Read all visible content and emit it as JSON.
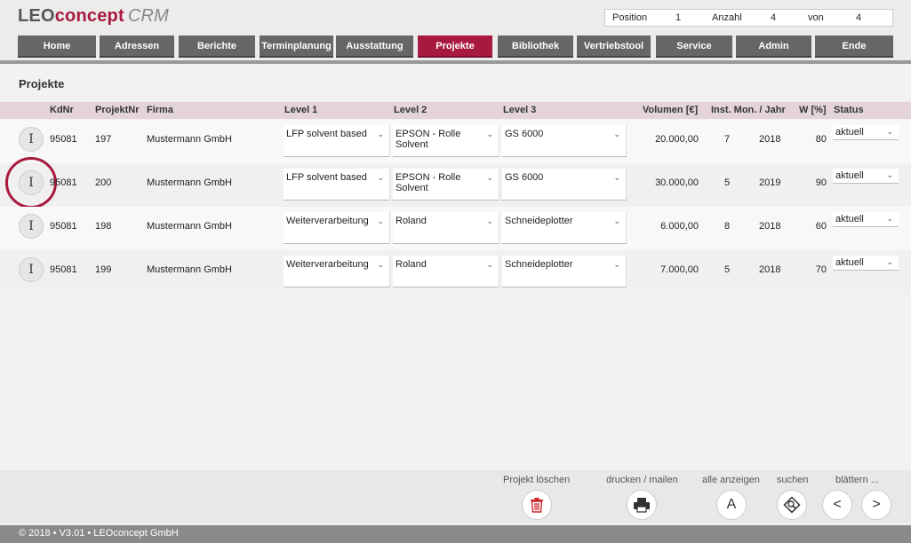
{
  "logo": {
    "leo": "LEO",
    "concept": "concept",
    "crm": "CRM"
  },
  "position_box": {
    "position_label": "Position",
    "position_value": "1",
    "anzahl_label": "Anzahl",
    "anzahl_value": "4",
    "von_label": "von",
    "von_value": "4"
  },
  "nav": [
    {
      "label": "Home"
    },
    {
      "label": "Adressen"
    },
    {
      "label": "Berichte"
    },
    {
      "label": "Terminplanung"
    },
    {
      "label": "Ausstattung"
    },
    {
      "label": "Projekte",
      "active": true
    },
    {
      "label": "Bibliothek"
    },
    {
      "label": "Vertriebstool"
    },
    {
      "label": "Service"
    },
    {
      "label": "Admin"
    },
    {
      "label": "Ende"
    }
  ],
  "section_title": "Projekte",
  "columns": [
    "KdNr",
    "ProjektNr",
    "Firma",
    "Level 1",
    "Level 2",
    "Level 3",
    "Volumen [€]",
    "Inst. Mon. / Jahr",
    "W [%]",
    "Status"
  ],
  "rows": [
    {
      "kdnr": "95081",
      "projektnr": "197",
      "firma": "Mustermann GmbH",
      "level1": "LFP solvent based",
      "level2": "EPSON - Rolle Solvent",
      "level3": "GS 6000",
      "volumen": "20.000,00",
      "mon": "7",
      "jahr": "2018",
      "w": "80",
      "status": "aktuell"
    },
    {
      "kdnr": "95081",
      "projektnr": "200",
      "firma": "Mustermann GmbH",
      "level1": "LFP solvent based",
      "level2": "EPSON - Rolle Solvent",
      "level3": "GS 6000",
      "volumen": "30.000,00",
      "mon": "5",
      "jahr": "2019",
      "w": "90",
      "status": "aktuell"
    },
    {
      "kdnr": "95081",
      "projektnr": "198",
      "firma": "Mustermann GmbH",
      "level1": "Weiterverarbeitung",
      "level2": "Roland",
      "level3": "Schneideplotter",
      "volumen": "6.000,00",
      "mon": "8",
      "jahr": "2018",
      "w": "60",
      "status": "aktuell"
    },
    {
      "kdnr": "95081",
      "projektnr": "199",
      "firma": "Mustermann GmbH",
      "level1": "Weiterverarbeitung",
      "level2": "Roland",
      "level3": "Schneideplotter",
      "volumen": "7.000,00",
      "mon": "5",
      "jahr": "2018",
      "w": "70",
      "status": "aktuell"
    }
  ],
  "row_button_glyph": "I",
  "actions": {
    "delete_label": "Projekt löschen",
    "print_label": "drucken / mailen",
    "show_all_label": "alle anzeigen",
    "show_all_glyph": "A",
    "search_label": "suchen",
    "browse_label": "blättern ...",
    "prev_glyph": "<",
    "next_glyph": ">"
  },
  "copyright": "© 2018 • V3.01 • LEOconcept GmbH",
  "colors": {
    "accent": "#a8193f",
    "nav": "#666666"
  }
}
